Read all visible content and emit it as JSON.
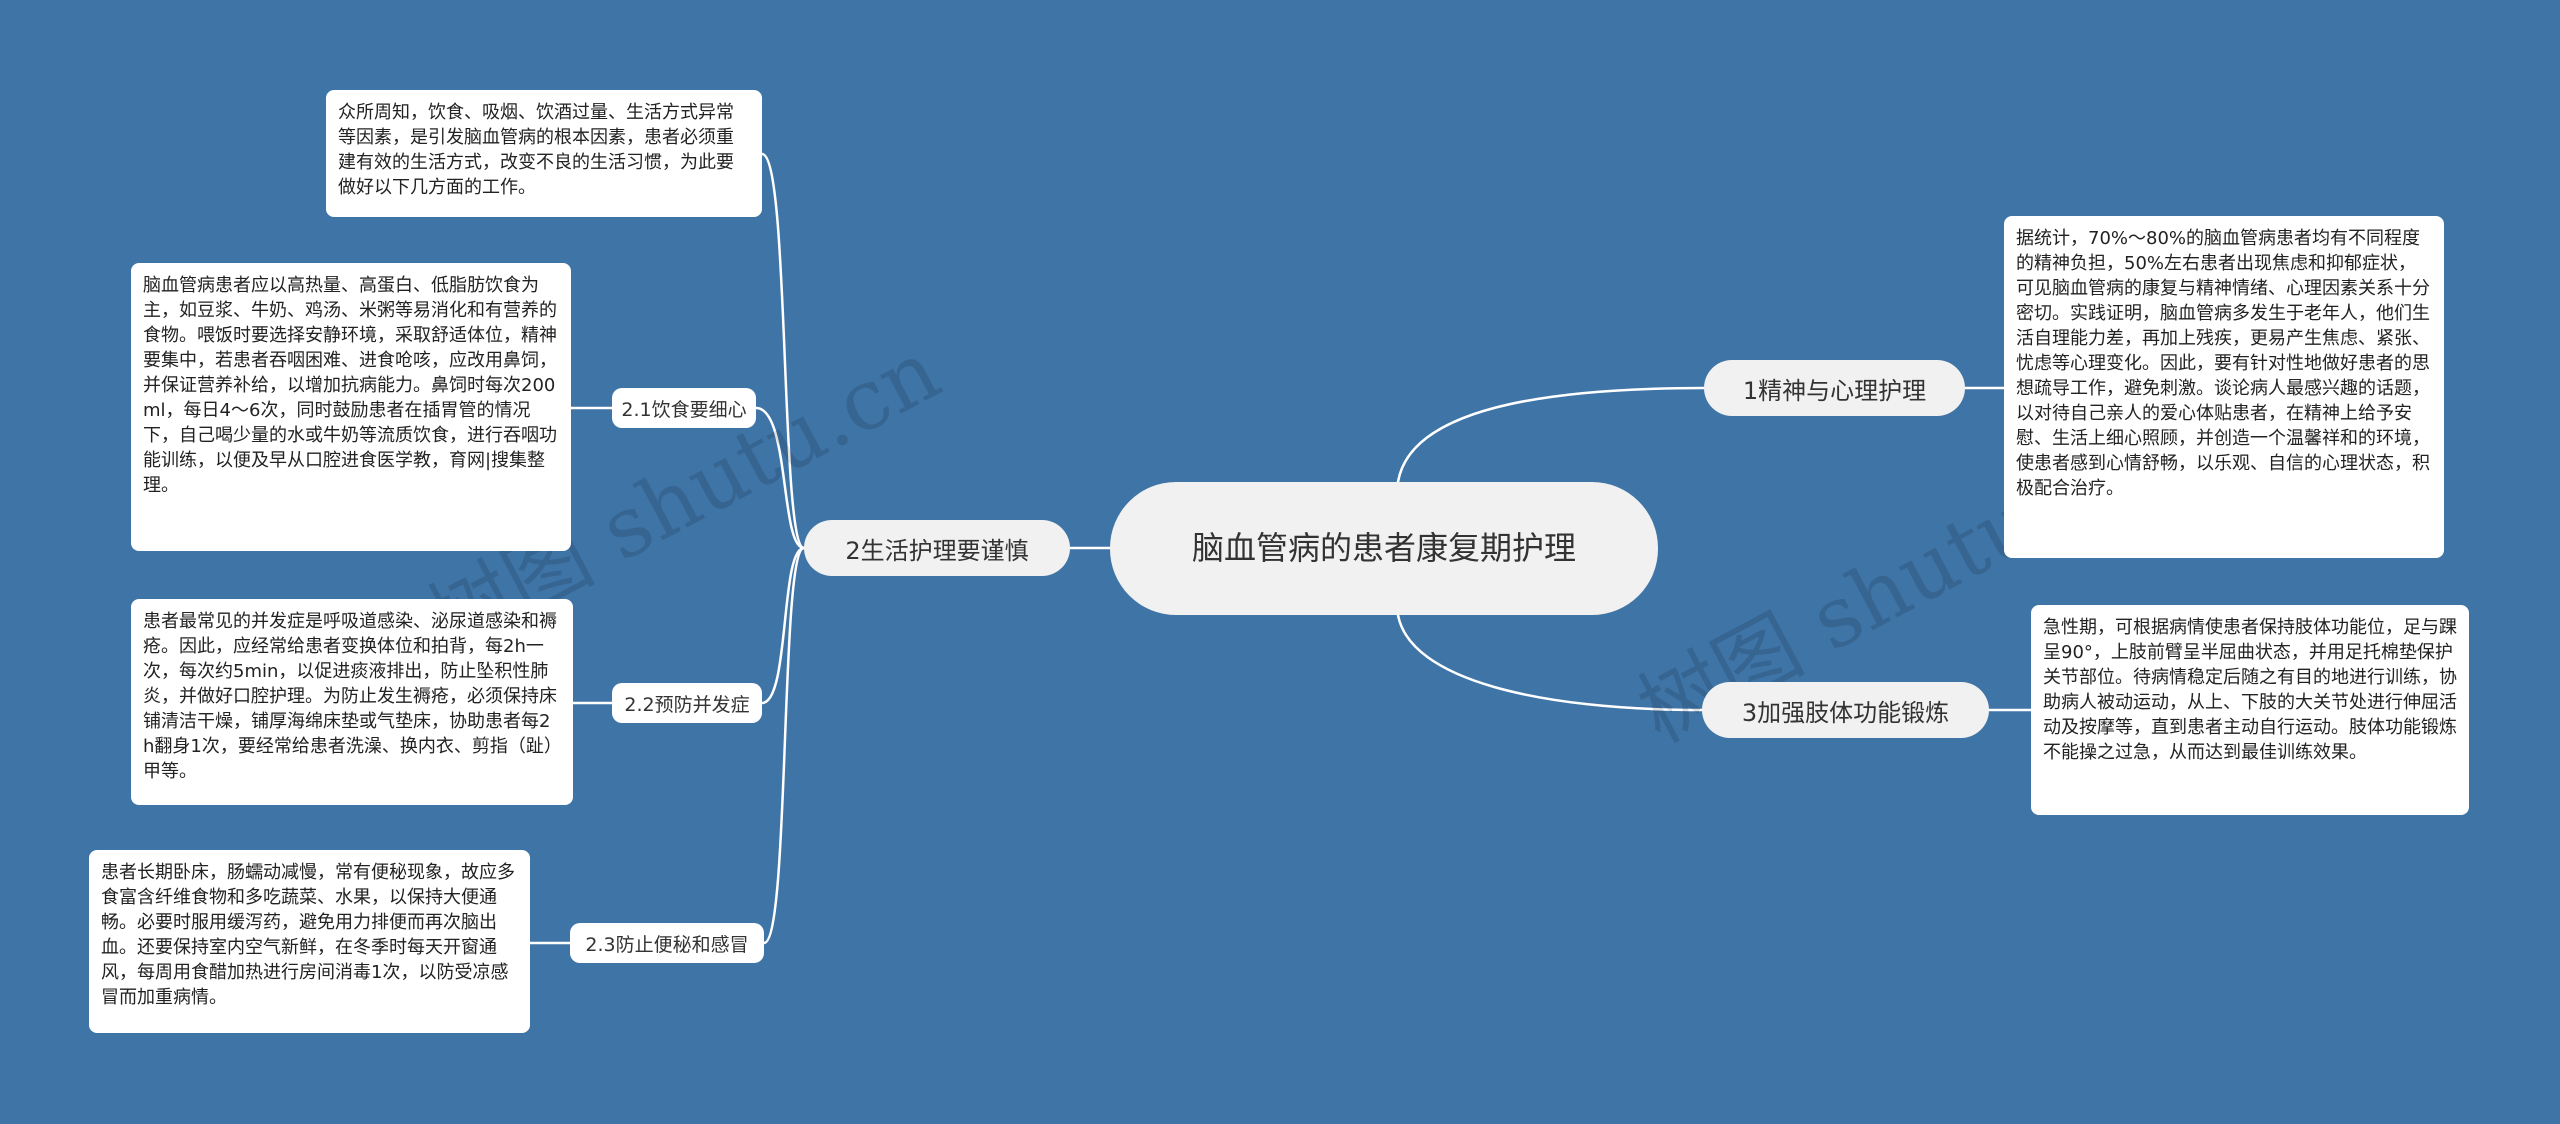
{
  "root": {
    "title": "脑血管病的患者康复期护理"
  },
  "branches": {
    "b1": {
      "label": "1精神与心理护理",
      "text": "据统计，70%～80%的脑血管病患者均有不同程度的精神负担，50%左右患者出现焦虑和抑郁症状，可见脑血管病的康复与精神情绪、心理因素关系十分密切。实践证明，脑血管病多发生于老年人，他们生活自理能力差，再加上残疾，更易产生焦虑、紧张、忧虑等心理变化。因此，要有针对性地做好患者的思想疏导工作，避免刺激。谈论病人最感兴趣的话题，以对待自己亲人的爱心体贴患者，在精神上给予安慰、生活上细心照顾，并创造一个温馨祥和的环境，使患者感到心情舒畅，以乐观、自信的心理状态，积极配合治疗。"
    },
    "b2": {
      "label": "2生活护理要谨慎",
      "intro": "众所周知，饮食、吸烟、饮酒过量、生活方式异常等因素，是引发脑血管病的根本因素，患者必须重建有效的生活方式，改变不良的生活习惯，为此要做好以下几方面的工作。",
      "subs": [
        {
          "label": "2.1饮食要细心",
          "text": "脑血管病患者应以高热量、高蛋白、低脂肪饮食为主，如豆浆、牛奶、鸡汤、米粥等易消化和有营养的食物。喂饭时要选择安静环境，采取舒适体位，精神要集中，若患者吞咽困难、进食呛咳，应改用鼻饲，并保证营养补给，以增加抗病能力。鼻饲时每次200ml，每日4～6次，同时鼓励患者在插胃管的情况下，自己喝少量的水或牛奶等流质饮食，进行吞咽功能训练，以便及早从口腔进食医学教，育网|搜集整理。"
        },
        {
          "label": "2.2预防并发症",
          "text": "患者最常见的并发症是呼吸道感染、泌尿道感染和褥疮。因此，应经常给患者变换体位和拍背，每2h一次，每次约5min，以促进痰液排出，防止坠积性肺炎，并做好口腔护理。为防止发生褥疮，必须保持床铺清洁干燥，铺厚海绵床垫或气垫床，协助患者每2h翻身1次，要经常给患者洗澡、换内衣、剪指（趾）甲等。"
        },
        {
          "label": "2.3防止便秘和感冒",
          "text": "患者长期卧床，肠蠕动减慢，常有便秘现象，故应多食富含纤维食物和多吃蔬菜、水果，以保持大便通畅。必要时服用缓泻药，避免用力排便而再次脑出血。还要保持室内空气新鲜，在冬季时每天开窗通风，每周用食醋加热进行房间消毒1次，以防受凉感冒而加重病情。"
        }
      ]
    },
    "b3": {
      "label": "3加强肢体功能锻炼",
      "text": "急性期，可根据病情使患者保持肢体功能位，足与踝呈90°，上肢前臂呈半屈曲状态，并用足托棉垫保护关节部位。待病情稳定后随之有目的地进行训练，协助病人被动运动，从上、下肢的大关节处进行伸屈活动及按摩等，直到患者主动自行运动。肢体功能锻炼不能操之过急，从而达到最佳训练效果。"
    }
  },
  "watermarks": [
    "树图 shutu.cn",
    "树图 shutu.cn"
  ],
  "colors": {
    "background": "#3f74a7",
    "connector": "#ffffff",
    "root_fill": "#f1f1f1",
    "leaf_fill": "#ffffff"
  }
}
